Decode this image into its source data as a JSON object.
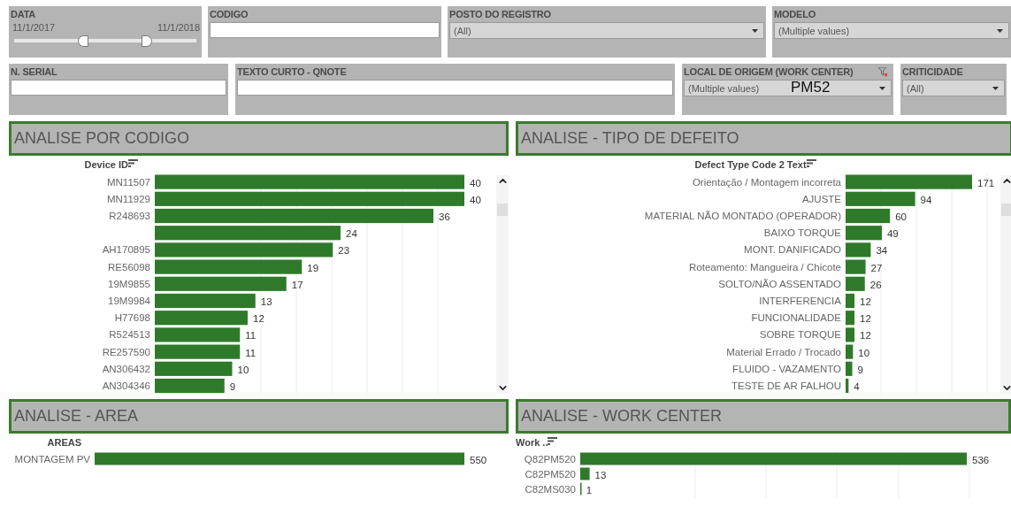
{
  "filters_row_1": [
    {
      "kind": "range",
      "label": "DATA",
      "start": "11/1/2017",
      "end": "11/1/2018",
      "lower": {
        "level": 0.37
      },
      "upper": {
        "level": 0.74
      }
    },
    {
      "kind": "text",
      "label": "CODIGO"
    },
    {
      "kind": "dropdown",
      "label": "POSTO DO REGISTRO",
      "value": "(All)",
      "filtered": false
    },
    {
      "kind": "dropdown",
      "label": "MODELO",
      "value": "(Multiple values)",
      "filtered": false
    }
  ],
  "filters_row_2": [
    {
      "kind": "text",
      "label": "N. SERIAL"
    },
    {
      "kind": "text",
      "label": "TEXTO CURTO - QNOTE"
    },
    {
      "kind": "dropdown",
      "label": "LOCAL DE ORIGEM (WORK CENTER)",
      "value": "(Multiple values)",
      "annotation": "PM52",
      "filtered": true
    },
    {
      "kind": "dropdown",
      "label": "CRITICIDADE",
      "value": "(All)",
      "filtered": false
    }
  ],
  "sections": [
    {
      "title": "ANALISE POR CODIGO",
      "scrollbar": true,
      "chart_data": {
        "type": "bar",
        "orientation": "horizontal",
        "ylabel": "Device ID",
        "categories": [
          "MN11507",
          "MN11929",
          "R248693",
          null,
          "AH170895",
          "RE56098",
          "19M9855",
          "19M9984",
          "H77698",
          "R524513",
          "RE257590",
          "AN306432",
          "AN304346"
        ],
        "values": [
          40,
          40,
          36,
          24,
          23,
          19,
          17,
          13,
          12,
          11,
          11,
          10,
          9
        ],
        "data_labels": true
      }
    },
    {
      "title": "ANALISE - TIPO DE DEFEITO",
      "scrollbar": true,
      "chart_data": {
        "type": "bar",
        "orientation": "horizontal",
        "ylabel": "Defect Type Code 2 Text",
        "categories": [
          "Orientação / Montagem incorreta",
          "AJUSTE",
          "MATERIAL NÃO MONTADO (OPERADOR)",
          "BAIXO TORQUE",
          "MONT. DANIFICADO",
          "Roteamento: Mangueira / Chicote",
          "SOLTO/NÃO ASSENTADO",
          "INTERFERENCIA",
          "FUNCIONALIDADE",
          "SOBRE TORQUE",
          "Material Errado / Trocado",
          "FLUIDO - VAZAMENTO",
          "TESTE DE AR FALHOU"
        ],
        "values": [
          171,
          94,
          60,
          49,
          34,
          27,
          26,
          12,
          12,
          12,
          10,
          9,
          4
        ],
        "data_labels": true
      }
    },
    {
      "title": "ANALISE - AREA",
      "chart_data": {
        "type": "bar",
        "orientation": "horizontal",
        "ylabel": "AREAS",
        "categories": [
          "MONTAGEM PV"
        ],
        "values": [
          550
        ],
        "data_labels": true
      }
    },
    {
      "title": "ANALISE - WORK CENTER",
      "chart_data": {
        "type": "bar",
        "orientation": "horizontal",
        "ylabel": "Work ..",
        "categories": [
          "Q82PM520",
          "C82PM520",
          "C82MS030"
        ],
        "values": [
          536,
          13,
          1
        ],
        "data_labels": true
      }
    }
  ]
}
